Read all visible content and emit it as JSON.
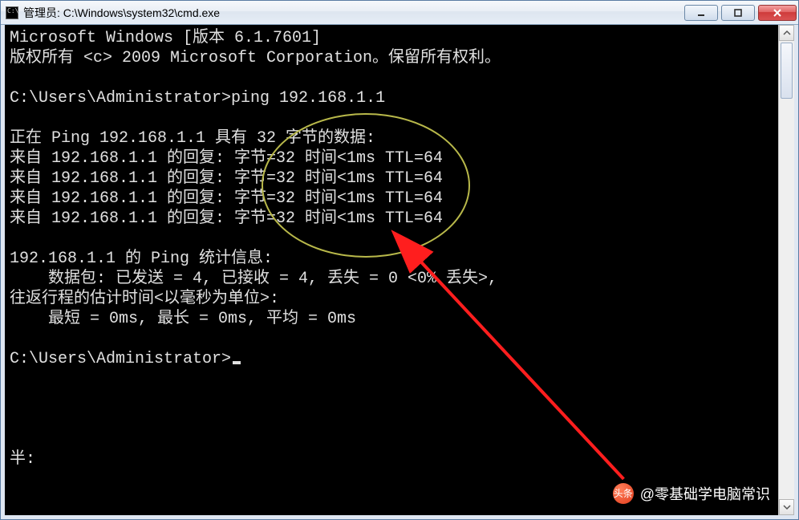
{
  "window": {
    "title": "管理员: C:\\Windows\\system32\\cmd.exe"
  },
  "console": {
    "line_version": "Microsoft Windows [版本 6.1.7601]",
    "line_copyright": "版权所有 <c> 2009 Microsoft Corporation。保留所有权利。",
    "prompt1": "C:\\Users\\Administrator>ping 192.168.1.1",
    "ping_header": "正在 Ping 192.168.1.1 具有 32 字节的数据:",
    "reply1": "来自 192.168.1.1 的回复: 字节=32 时间<1ms TTL=64",
    "reply2": "来自 192.168.1.1 的回复: 字节=32 时间<1ms TTL=64",
    "reply3": "来自 192.168.1.1 的回复: 字节=32 时间<1ms TTL=64",
    "reply4": "来自 192.168.1.1 的回复: 字节=32 时间<1ms TTL=64",
    "stats_header": "192.168.1.1 的 Ping 统计信息:",
    "stats_packets": "    数据包: 已发送 = 4, 已接收 = 4, 丢失 = 0 <0% 丢失>,",
    "stats_rtt_header": "往返行程的估计时间<以毫秒为单位>:",
    "stats_rtt": "    最短 = 0ms, 最长 = 0ms, 平均 = 0ms",
    "prompt2": "C:\\Users\\Administrator>",
    "truncated_bottom": "半:"
  },
  "watermark": {
    "badge": "头条",
    "text": "@零基础学电脑常识"
  },
  "icons": {
    "minimize": "minimize-icon",
    "maximize": "maximize-icon",
    "close": "close-icon",
    "scroll_up": "chevron-up-icon",
    "scroll_down": "chevron-down-icon"
  },
  "annotation": {
    "circle_color": "#b8b84a",
    "arrow_color": "#ff1e1e"
  }
}
